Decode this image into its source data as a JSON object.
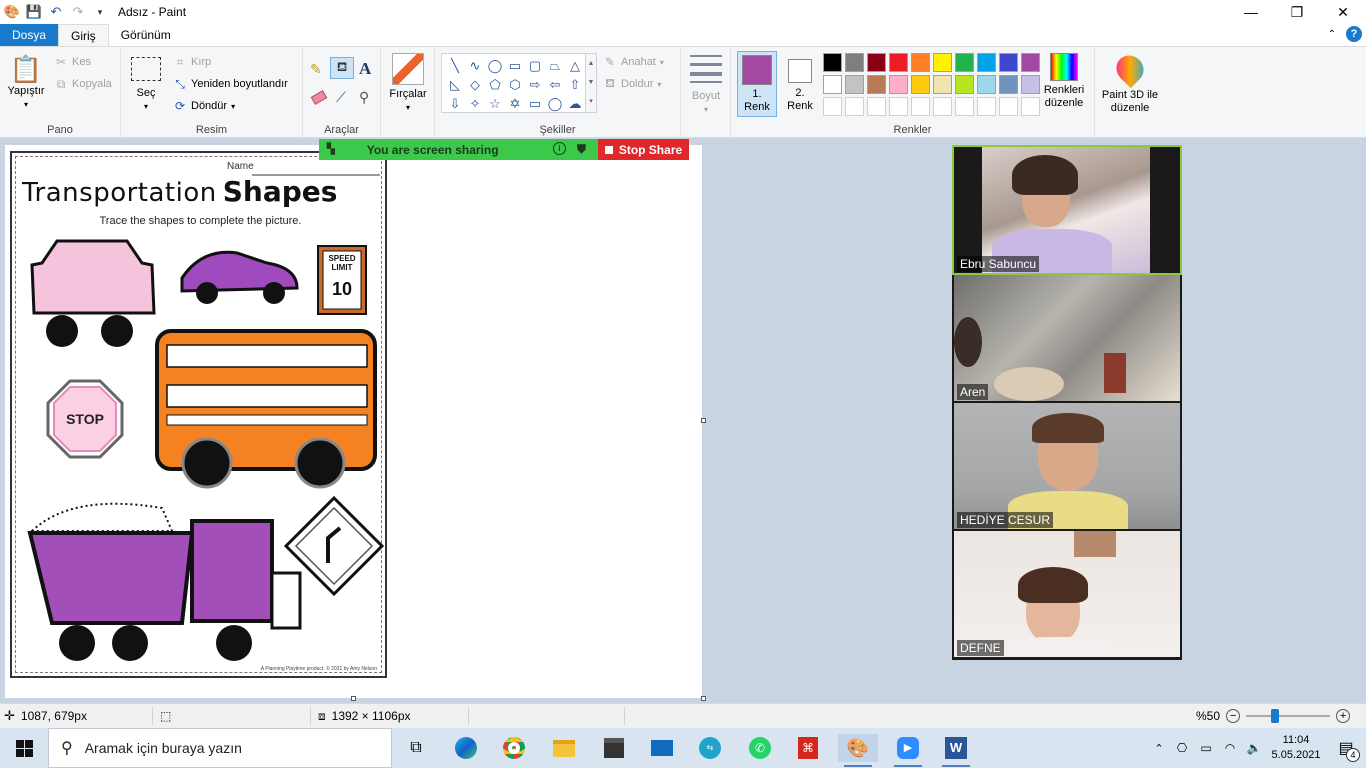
{
  "window": {
    "title": "Adsız - Paint"
  },
  "tabs": [
    "Dosya",
    "Giriş",
    "Görünüm"
  ],
  "ribbon": {
    "clipboard": {
      "paste": "Yapıştır",
      "cut": "Kes",
      "copy": "Kopyala",
      "label": "Pano"
    },
    "image": {
      "select": "Seç",
      "crop": "Kırp",
      "resize": "Yeniden boyutlandır",
      "rotate": "Döndür",
      "label": "Resim"
    },
    "tools": {
      "label": "Araçlar"
    },
    "brushes": {
      "label": "Fırçalar"
    },
    "shapes": {
      "outline": "Anahat",
      "fill": "Doldur",
      "label": "Şekiller"
    },
    "size": {
      "label": "Boyut"
    },
    "colors": {
      "color1": "1. Renk",
      "color2": "2. Renk",
      "edit": "Renkleri düzenle",
      "label": "Renkler",
      "color1_value": "#a349a4",
      "color2_value": "#ffffff",
      "palette_row1": [
        "#000000",
        "#7f7f7f",
        "#880015",
        "#ed1c24",
        "#ff7f27",
        "#fff200",
        "#22b14c",
        "#00a2e8",
        "#3f48cc",
        "#a349a4"
      ],
      "palette_row2": [
        "#ffffff",
        "#c3c3c3",
        "#b97a57",
        "#ffaec9",
        "#ffc90e",
        "#efe4b0",
        "#b5e61d",
        "#99d9ea",
        "#7092be",
        "#c8bfe7"
      ]
    },
    "paint3d": "Paint 3D ile düzenle"
  },
  "zoom_share": {
    "status": "You are screen sharing",
    "stop": "Stop Share"
  },
  "worksheet": {
    "name_label": "Name",
    "title_a": "Transportation",
    "title_b": "Shapes",
    "subtitle": "Trace the shapes to complete the picture.",
    "sign_speed": "SPEED LIMIT",
    "sign_speed_num": "10",
    "sign_stop": "STOP",
    "footer": "A Planning Playtime product. © 2021 by Amy Nelson"
  },
  "participants": [
    {
      "name": "Ebru Sabuncu",
      "active": true
    },
    {
      "name": "Aren",
      "active": false
    },
    {
      "name": "HEDİYE CESUR",
      "active": false
    },
    {
      "name": "DEFNE",
      "active": false
    }
  ],
  "statusbar": {
    "cursor": "1087, 679px",
    "size": "1392 × 1106px",
    "zoom": "%50",
    "zoom_level": 50
  },
  "taskbar": {
    "search_placeholder": "Aramak için buraya yazın",
    "time": "11:04",
    "date": "5.05.2021",
    "notifications": "4"
  }
}
